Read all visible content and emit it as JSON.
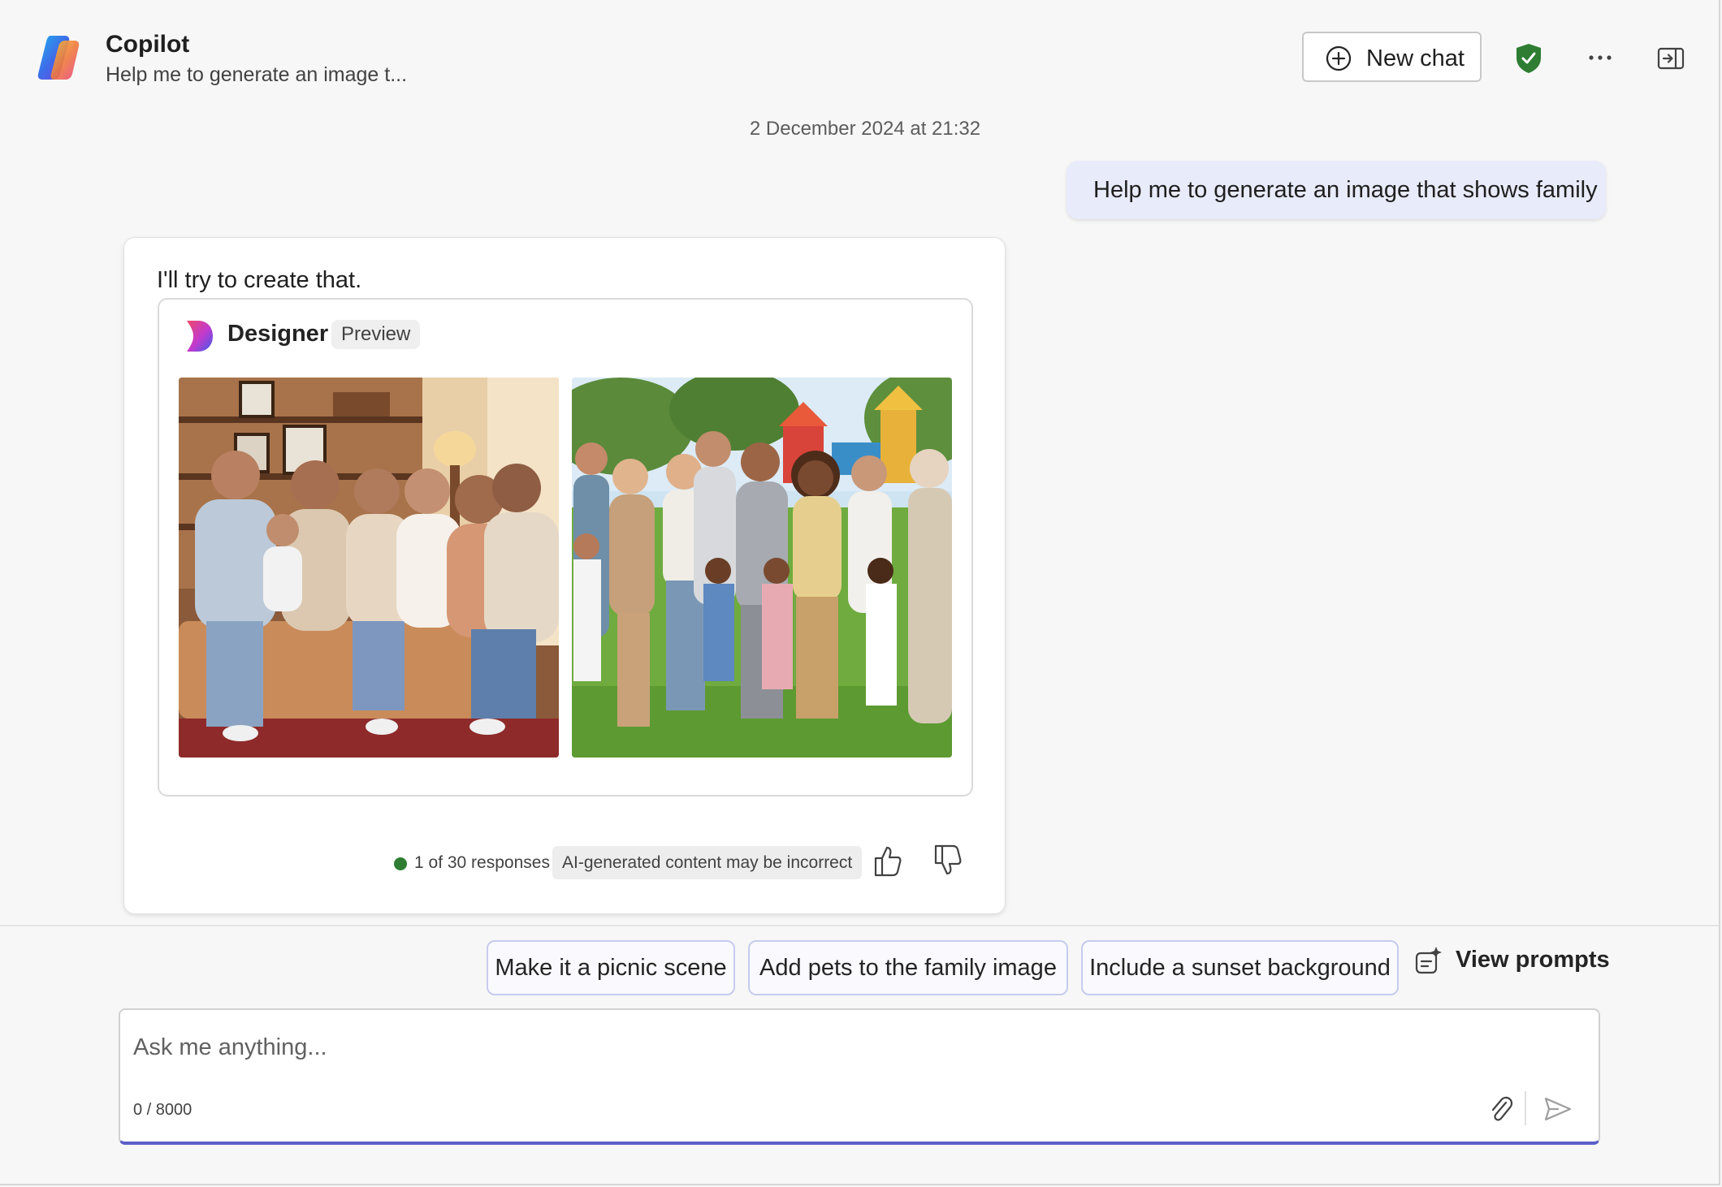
{
  "header": {
    "title": "Copilot",
    "subtitle": "Help me to generate an image t...",
    "new_chat_label": "New chat",
    "icons": [
      "copilot-logo",
      "add-circle-icon",
      "shield-check-icon",
      "more-horizontal-icon",
      "panel-toggle-icon"
    ],
    "colors": {
      "shield": "#2e7d32"
    }
  },
  "conversation": {
    "timestamp": "2 December 2024 at 21:32",
    "user_message": "Help me to generate an image that shows family",
    "bot": {
      "text": "I'll try to create that.",
      "designer": {
        "title": "Designer",
        "badge": "Preview",
        "images": [
          {
            "name": "family-living-room-image"
          },
          {
            "name": "family-park-image"
          }
        ]
      },
      "footer": {
        "responses": "1 of 30 responses",
        "disclaimer": "AI-generated content may be incorrect",
        "status_color": "#2e7d32"
      }
    }
  },
  "suggestions": [
    "Make it a picnic scene",
    "Add pets to the family image",
    "Include a sunset background"
  ],
  "view_prompts_label": "View prompts",
  "compose": {
    "placeholder": "Ask me anything...",
    "char_count": "0 / 8000",
    "accent": "#5b5fc7"
  }
}
